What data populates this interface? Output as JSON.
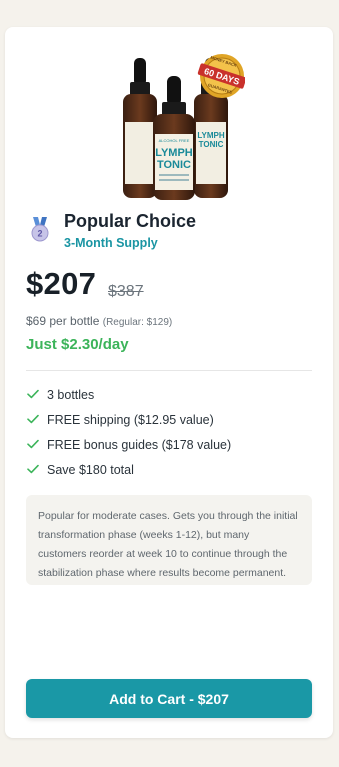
{
  "product": {
    "image_name": "lymph-tonic-bottles",
    "bottle_brand": "LYMPH",
    "bottle_brand_2": "TONIC",
    "bottle_tag": "ALCOHOL FREE",
    "badge_top": "MONEY BACK",
    "badge_main": "60 DAYS",
    "badge_bottom": "GUARANTEE"
  },
  "plan": {
    "icon": "medal-icon",
    "rank": "2",
    "name": "Popular Choice",
    "supply": "3-Month Supply"
  },
  "pricing": {
    "price": "$207",
    "old_price": "$387",
    "per_bottle": "$69 per bottle",
    "regular": "(Regular: $129)",
    "per_day": "Just $2.30/day"
  },
  "features": [
    {
      "icon": "check-icon",
      "text": "3 bottles"
    },
    {
      "icon": "check-icon",
      "text": "FREE shipping ($12.95 value)"
    },
    {
      "icon": "check-icon",
      "text": "FREE bonus guides ($178 value)"
    },
    {
      "icon": "check-icon",
      "text": "Save $180 total"
    }
  ],
  "note": "Popular for moderate cases. Gets you through the initial transformation phase (weeks 1-12), but many customers reorder at week 10 to continue through the stabilization phase where results become permanent.",
  "cta": {
    "label": "Add to Cart - $207"
  },
  "colors": {
    "accent": "#1a98a6",
    "price_green": "#3cb45a",
    "check_green": "#3cb45a",
    "medal_blue": "#5a8fd8",
    "badge_gold": "#e0a526",
    "badge_red": "#c9312b"
  }
}
